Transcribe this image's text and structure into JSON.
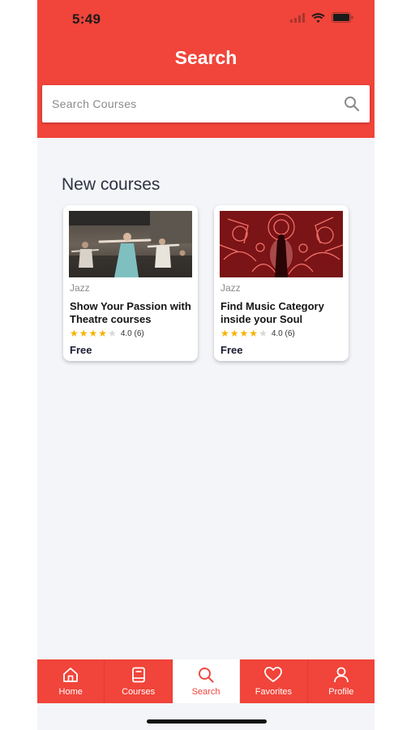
{
  "status_bar": {
    "time": "5:49"
  },
  "header": {
    "title": "Search"
  },
  "search": {
    "placeholder": "Search Courses",
    "value": ""
  },
  "section": {
    "title": "New courses"
  },
  "courses": [
    {
      "category": "Jazz",
      "title": "Show Your Passion with Theatre courses",
      "rating": 4,
      "rating_text": "4.0 (6)",
      "price": "Free",
      "image": "dancers-photo"
    },
    {
      "category": "Jazz",
      "title": "Find Music Category inside your Soul",
      "rating": 4,
      "rating_text": "4.0 (6)",
      "price": "Free",
      "image": "neon-music-illustration"
    }
  ],
  "tabbar": {
    "items": [
      {
        "label": "Home",
        "icon": "home-icon"
      },
      {
        "label": "Courses",
        "icon": "book-icon"
      },
      {
        "label": "Search",
        "icon": "search-icon",
        "active": true
      },
      {
        "label": "Favorites",
        "icon": "heart-icon"
      },
      {
        "label": "Profile",
        "icon": "user-icon"
      }
    ]
  },
  "colors": {
    "brand": "#f1443a",
    "background": "#f4f5f9",
    "star": "#f5b301"
  }
}
